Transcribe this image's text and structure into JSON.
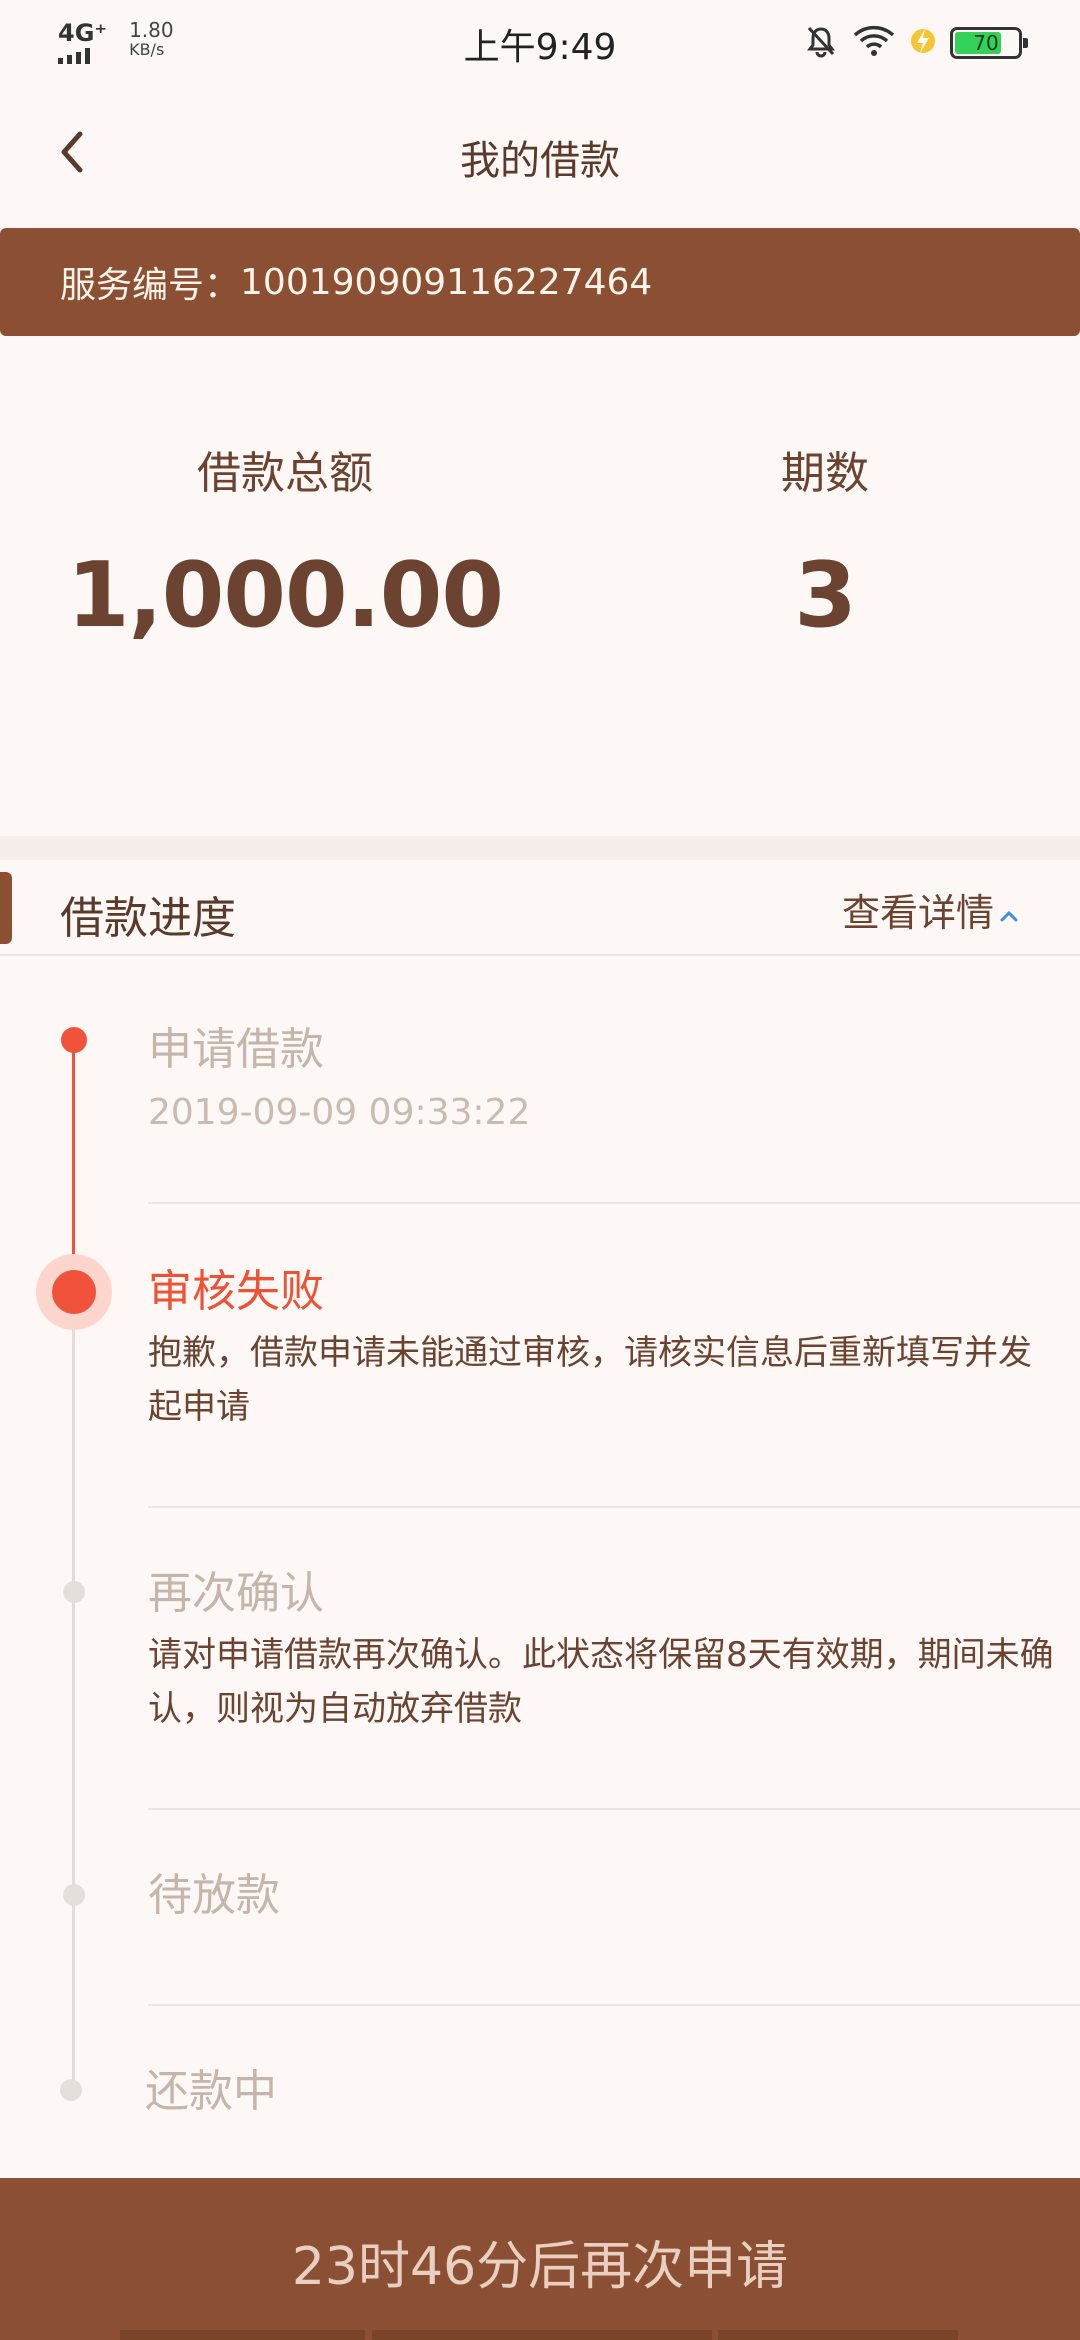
{
  "status_bar": {
    "network": "4G⁺",
    "speed_value": "1.80",
    "speed_unit": "KB/s",
    "time": "上午9:49",
    "battery_level": "70",
    "battery_percent": 70
  },
  "nav": {
    "title": "我的借款"
  },
  "service": {
    "label": "服务编号：",
    "number": "100190909116227464"
  },
  "summary": {
    "amount_label": "借款总额",
    "amount_value": "1,000.00",
    "periods_label": "期数",
    "periods_value": "3"
  },
  "progress": {
    "title": "借款进度",
    "details_link": "查看详情",
    "steps": [
      {
        "title": "申请借款",
        "subtitle": "2019-09-09 09:33:22"
      },
      {
        "title": "审核失败",
        "description": "抱歉，借款申请未能通过审核，请核实信息后重新填写并发起申请"
      },
      {
        "title": "再次确认",
        "description": "请对申请借款再次确认。此状态将保留8天有效期，期间未确认，则视为自动放弃借款"
      },
      {
        "title": "待放款"
      },
      {
        "title": "还款中"
      }
    ]
  },
  "bottom_button": {
    "label": "23时46分后再次申请"
  },
  "colors": {
    "brand": "#8b5034",
    "accent_red": "#f0533a",
    "background": "#fdf8f5"
  }
}
